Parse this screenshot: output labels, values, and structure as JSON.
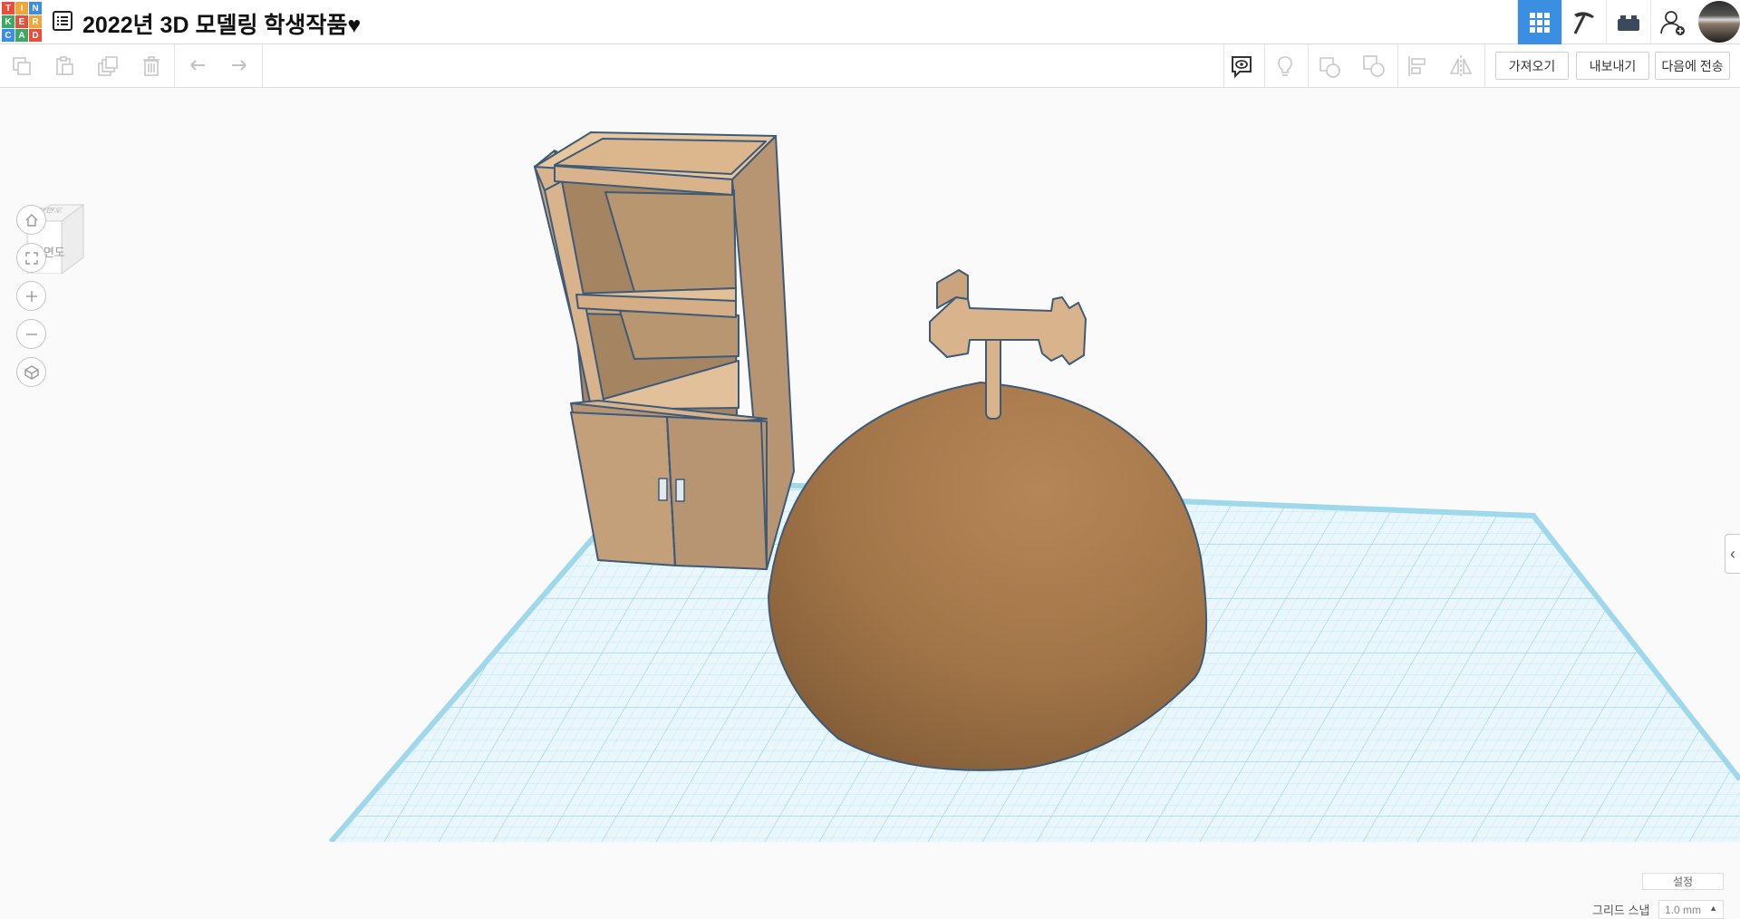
{
  "app": {
    "logo_letters": [
      "T",
      "I",
      "N",
      "K",
      "E",
      "R",
      "C",
      "A",
      "D"
    ],
    "logo_colors": [
      "#e94e3d",
      "#f2a434",
      "#3b8fe3",
      "#3ba864",
      "#e94e3d",
      "#f2a434",
      "#3b8fe3",
      "#3ba864",
      "#e94e3d"
    ],
    "project_title": "2022년 3D 모델링 학생작품♥"
  },
  "top_icons": [
    "grid-view-icon",
    "pickaxe-icon",
    "bricks-icon",
    "add-user-icon",
    "avatar"
  ],
  "toolbar": {
    "left_tools": [
      "copy-icon",
      "paste-icon",
      "duplicate-icon",
      "delete-icon",
      "undo-icon",
      "redo-icon"
    ],
    "right_tools": [
      "notes-icon",
      "light-bulb-icon",
      "shape-group-icon",
      "shape-ungroup-icon",
      "align-icon",
      "mirror-icon"
    ],
    "import_label": "가져오기",
    "export_label": "내보내기",
    "send_to_label": "다음에 전송"
  },
  "viewcube": {
    "top_label": "평면도",
    "front_label": "정면도"
  },
  "nav_controls": [
    "home-view-icon",
    "fit-view-icon",
    "zoom-in-icon",
    "zoom-out-icon",
    "perspective-icon"
  ],
  "bottom": {
    "settings_label": "설정",
    "grid_snap_label": "그리드 스냅",
    "grid_snap_value": "1.0 mm"
  },
  "colors": {
    "accent": "#3b8fe3",
    "workplane_grid": "#bfe6f2",
    "dome": "#a87a4c",
    "cabinet": "#d9b38b"
  }
}
